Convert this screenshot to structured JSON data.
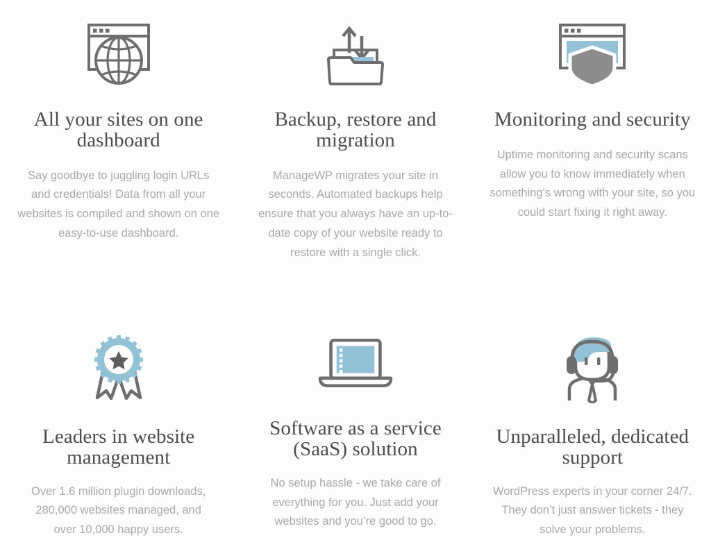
{
  "page": {
    "background_color": "#fdfdfd",
    "heading_color": "#4d4d4d",
    "body_text_color": "#a9a9a9",
    "icon_stroke_color": "#6e6e6e",
    "icon_accent_color": "#93c2d6"
  },
  "features": [
    {
      "icon": "browser-globe-icon",
      "title": "All your sites on one dashboard",
      "description": "Say goodbye to juggling login URLs and credentials! Data from all your websites is compiled and shown on one easy-to-use dashboard."
    },
    {
      "icon": "folder-upload-download-icon",
      "title": "Backup, restore and migration",
      "description": "ManageWP migrates your site in seconds. Automated backups help ensure that you always have an up-to-date copy of your website ready to restore with a single click."
    },
    {
      "icon": "browser-shield-icon",
      "title": "Monitoring and security",
      "description": "Uptime monitoring and security scans allow you to know immediately when something's wrong with your site, so you could start fixing it right away."
    },
    {
      "icon": "award-ribbon-star-icon",
      "title": "Leaders in website management",
      "description": "Over 1.6 million plugin downloads, 280,000 websites managed, and over 10,000 happy users."
    },
    {
      "icon": "laptop-icon",
      "title": "Software as a service (SaaS) solution",
      "description": "No setup hassle - we take care of everything for you. Just add your websites and you’re good to go."
    },
    {
      "icon": "support-agent-headset-icon",
      "title": "Unparalleled, dedicated support",
      "description": "WordPress experts in your corner 24/7. They don’t just answer tickets - they solve your problems."
    }
  ]
}
